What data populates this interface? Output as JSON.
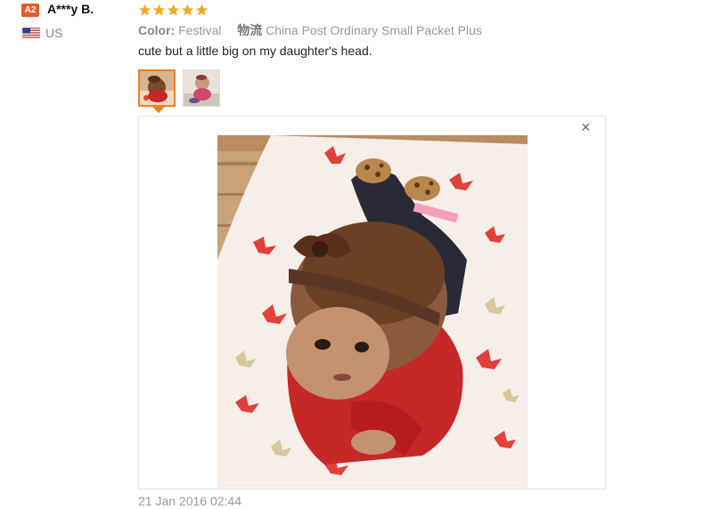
{
  "reviewer": {
    "level_badge": "A2",
    "name": "A***y B.",
    "country": "US",
    "flag_icon": "us-flag-icon"
  },
  "rating": {
    "stars": 5,
    "max": 5,
    "color": "#f5a623"
  },
  "meta": {
    "color_label": "Color:",
    "color_value": "Festival",
    "shipping_label": "物流",
    "shipping_value": "China Post Ordinary Small Packet Plus"
  },
  "review": {
    "text": "cute but a little big on my daughter's head.",
    "date": "21 Jan 2016 02:44"
  },
  "thumbnails": [
    {
      "name": "photo-thumbnail-1",
      "active": true
    },
    {
      "name": "photo-thumbnail-2",
      "active": false
    }
  ],
  "viewer": {
    "close_icon": "close-icon"
  },
  "colors": {
    "accent": "#e8812b",
    "badge": "#e15c2b",
    "star": "#f5a623"
  }
}
